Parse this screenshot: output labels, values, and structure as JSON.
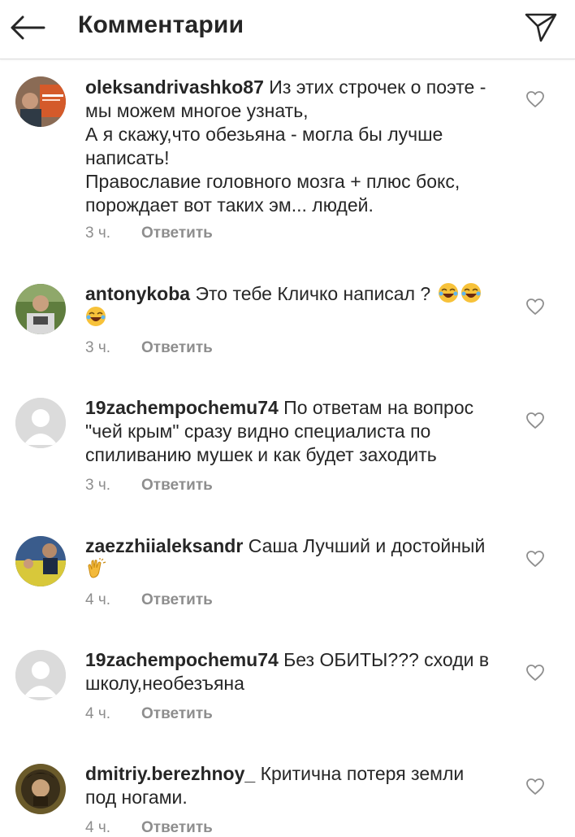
{
  "header": {
    "title": "Комментарии"
  },
  "comments": [
    {
      "username": "oleksandrivashko87",
      "text": "Из этих строчек о поэте - мы можем многое узнать,\nА я скажу,что обезьяна - могла бы лучше написать!\nПравославие головного мозга + плюс бокс, порождает вот таких эм... людей.",
      "lines": [
        "Из этих строчек о поэте -",
        "мы можем многое узнать,",
        "А я скажу,что обезьяна - могла бы лучше",
        "написать!",
        "Православие головного мозга + плюс бокс,",
        "порождает вот таких эм... людей."
      ],
      "time": "3 ч.",
      "reply": "Ответить",
      "avatar_badge": "Обережно! правий пришельник"
    },
    {
      "username": "antonykoba",
      "text": "Это тебе Кличко написал ?",
      "emojis": [
        "face-with-tears-of-joy",
        "face-with-tears-of-joy",
        "face-with-tears-of-joy"
      ],
      "time": "3 ч.",
      "reply": "Ответить"
    },
    {
      "username": "19zachempochemu74",
      "lines": [
        "По ответам на вопрос",
        "\"чей крым\" сразу видно специалиста по",
        "спиливанию мушек и как будет заходить"
      ],
      "time": "3 ч.",
      "reply": "Ответить"
    },
    {
      "username": "zaezzhiialeksandr",
      "text": "Саша Лучший и достойный",
      "emojis": [
        "clapping-hands"
      ],
      "time": "4 ч.",
      "reply": "Ответить"
    },
    {
      "username": "19zachempochemu74",
      "lines": [
        "Без ОБИТЫ??? сходи в",
        "школу,необезъяна"
      ],
      "time": "4 ч.",
      "reply": "Ответить"
    },
    {
      "username": "dmitriy.berezhnoy_",
      "lines": [
        "Критична потеря земли",
        "под ногами."
      ],
      "time": "4 ч.",
      "reply": "Ответить"
    }
  ],
  "icons": {
    "back": "arrow-left-icon",
    "share": "paper-plane-icon",
    "like": "heart-outline-icon"
  },
  "colors": {
    "text": "#262626",
    "secondary": "#8e8e8e",
    "divider": "#dbdbdb"
  }
}
